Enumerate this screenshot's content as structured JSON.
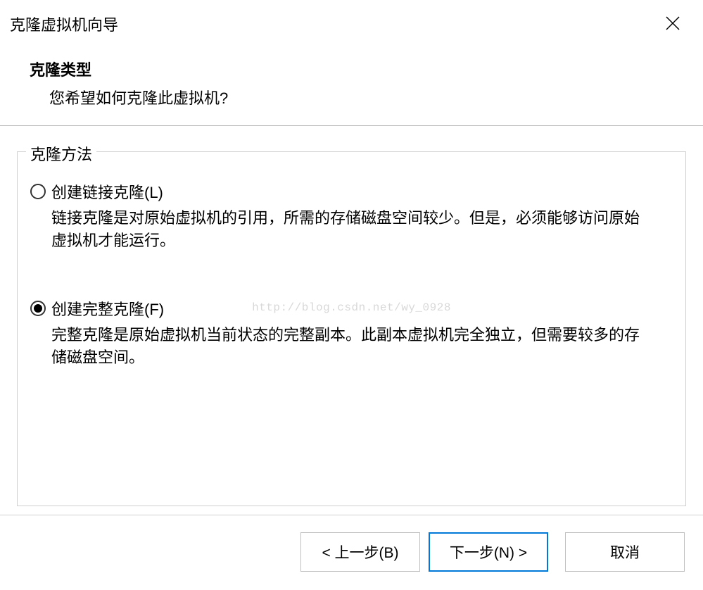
{
  "window": {
    "title": "克隆虚拟机向导"
  },
  "header": {
    "title": "克隆类型",
    "subtitle": "您希望如何克隆此虚拟机?"
  },
  "group": {
    "legend": "克隆方法",
    "options": [
      {
        "label": "创建链接克隆(L)",
        "description": "链接克隆是对原始虚拟机的引用，所需的存储磁盘空间较少。但是，必须能够访问原始虚拟机才能运行。",
        "selected": false
      },
      {
        "label": "创建完整克隆(F)",
        "description": "完整克隆是原始虚拟机当前状态的完整副本。此副本虚拟机完全独立，但需要较多的存储磁盘空间。",
        "selected": true
      }
    ]
  },
  "watermark": "http://blog.csdn.net/wy_0928",
  "buttons": {
    "back": "< 上一步(B)",
    "next": "下一步(N) >",
    "cancel": "取消"
  }
}
